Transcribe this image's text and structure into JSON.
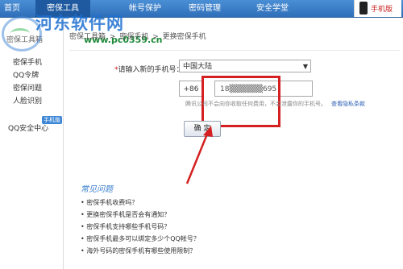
{
  "nav": {
    "tabs": [
      {
        "label": "首页"
      },
      {
        "label": "密保工具"
      },
      {
        "label": "帐号保护"
      },
      {
        "label": "密码管理"
      },
      {
        "label": "安全学堂"
      }
    ],
    "badge_label": "手机版"
  },
  "watermark": {
    "title": "河东软件网",
    "url": "www.pc0359.cn"
  },
  "sidebar": {
    "header": "密保工具箱",
    "items": [
      {
        "label": "密保手机"
      },
      {
        "label": "QQ令牌"
      },
      {
        "label": "密保问题"
      },
      {
        "label": "人脸识别"
      }
    ],
    "qq_center": "QQ安全中心",
    "qq_badge": "手机版"
  },
  "breadcrumb": [
    "密保工具箱",
    ">",
    "密保手机",
    ">",
    "更换密保手机"
  ],
  "form": {
    "phone_label_prefix": "*",
    "phone_label": "请输入新的手机号：",
    "country_value": "中国大陆",
    "country_code": "+86",
    "phone_value": "18▒▒▒▒▒▒695",
    "hint_text": "腾讯公司不会向你收取任何费用，不会泄露你的手机号。",
    "hint_link": "查看隐私条款",
    "confirm_label": "确 定"
  },
  "faq": {
    "title": "常见问题",
    "items": [
      "密保手机收费吗？",
      "更换密保手机是否会有通知？",
      "密保手机支持哪些手机号码？",
      "密保手机最多可以绑定多少个QQ帐号？",
      "海外号码的密保手机有哪些使用限制？"
    ]
  },
  "colors": {
    "nav_bg": "#2f6fb9",
    "highlight_red": "#d42020",
    "link_blue": "#2a5fb5",
    "watermark_blue": "#1d6fd1",
    "watermark_green": "#1e8a3a"
  }
}
